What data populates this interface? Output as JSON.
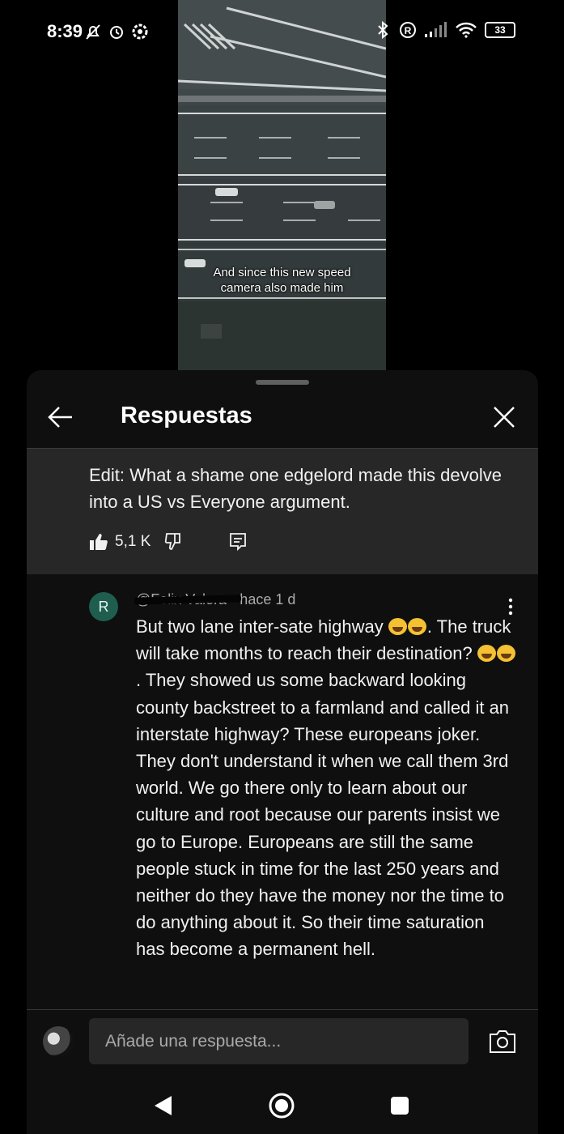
{
  "status_bar": {
    "time": "8:39",
    "battery": "33",
    "icons": [
      "notifications-off-icon",
      "alarm-icon",
      "settings-icon",
      "bluetooth-icon",
      "registered-icon",
      "signal-icon",
      "wifi-icon",
      "battery-icon"
    ]
  },
  "video": {
    "caption_line1": "And since this new speed",
    "caption_line2": "camera also made him"
  },
  "panel": {
    "title": "Respuestas",
    "back_icon": "back-arrow-icon",
    "close_icon": "close-icon"
  },
  "parent_comment": {
    "text": "Edit: What a shame one edgelord made this devolve into a US vs Everyone argument.",
    "likes": "5,1 K",
    "icons": [
      "thumbs-up-filled-icon",
      "thumbs-down-icon",
      "reply-icon"
    ]
  },
  "reply": {
    "avatar_letter": "R",
    "author": "@Felix Valera",
    "time": "• hace 1 d",
    "text_part1": "But two lane inter-sate highway ",
    "text_part2": ". The truck will take months to reach their destination? ",
    "text_part3": ". They showed us some backward looking county backstreet to a farmland and called it an interstate highway? These europeans joker. They don't understand it when we call them 3rd world. We go there only to learn about our culture and root because our parents insist we go to Europe. Europeans are still the same people stuck in time for the last 250 years and neither do they have the money nor the time to do anything about it. So their time saturation has become a permanent hell."
  },
  "input": {
    "placeholder": "Añade una respuesta..."
  },
  "nav": {
    "icons": [
      "nav-back-icon",
      "nav-home-icon",
      "nav-recents-icon"
    ]
  }
}
